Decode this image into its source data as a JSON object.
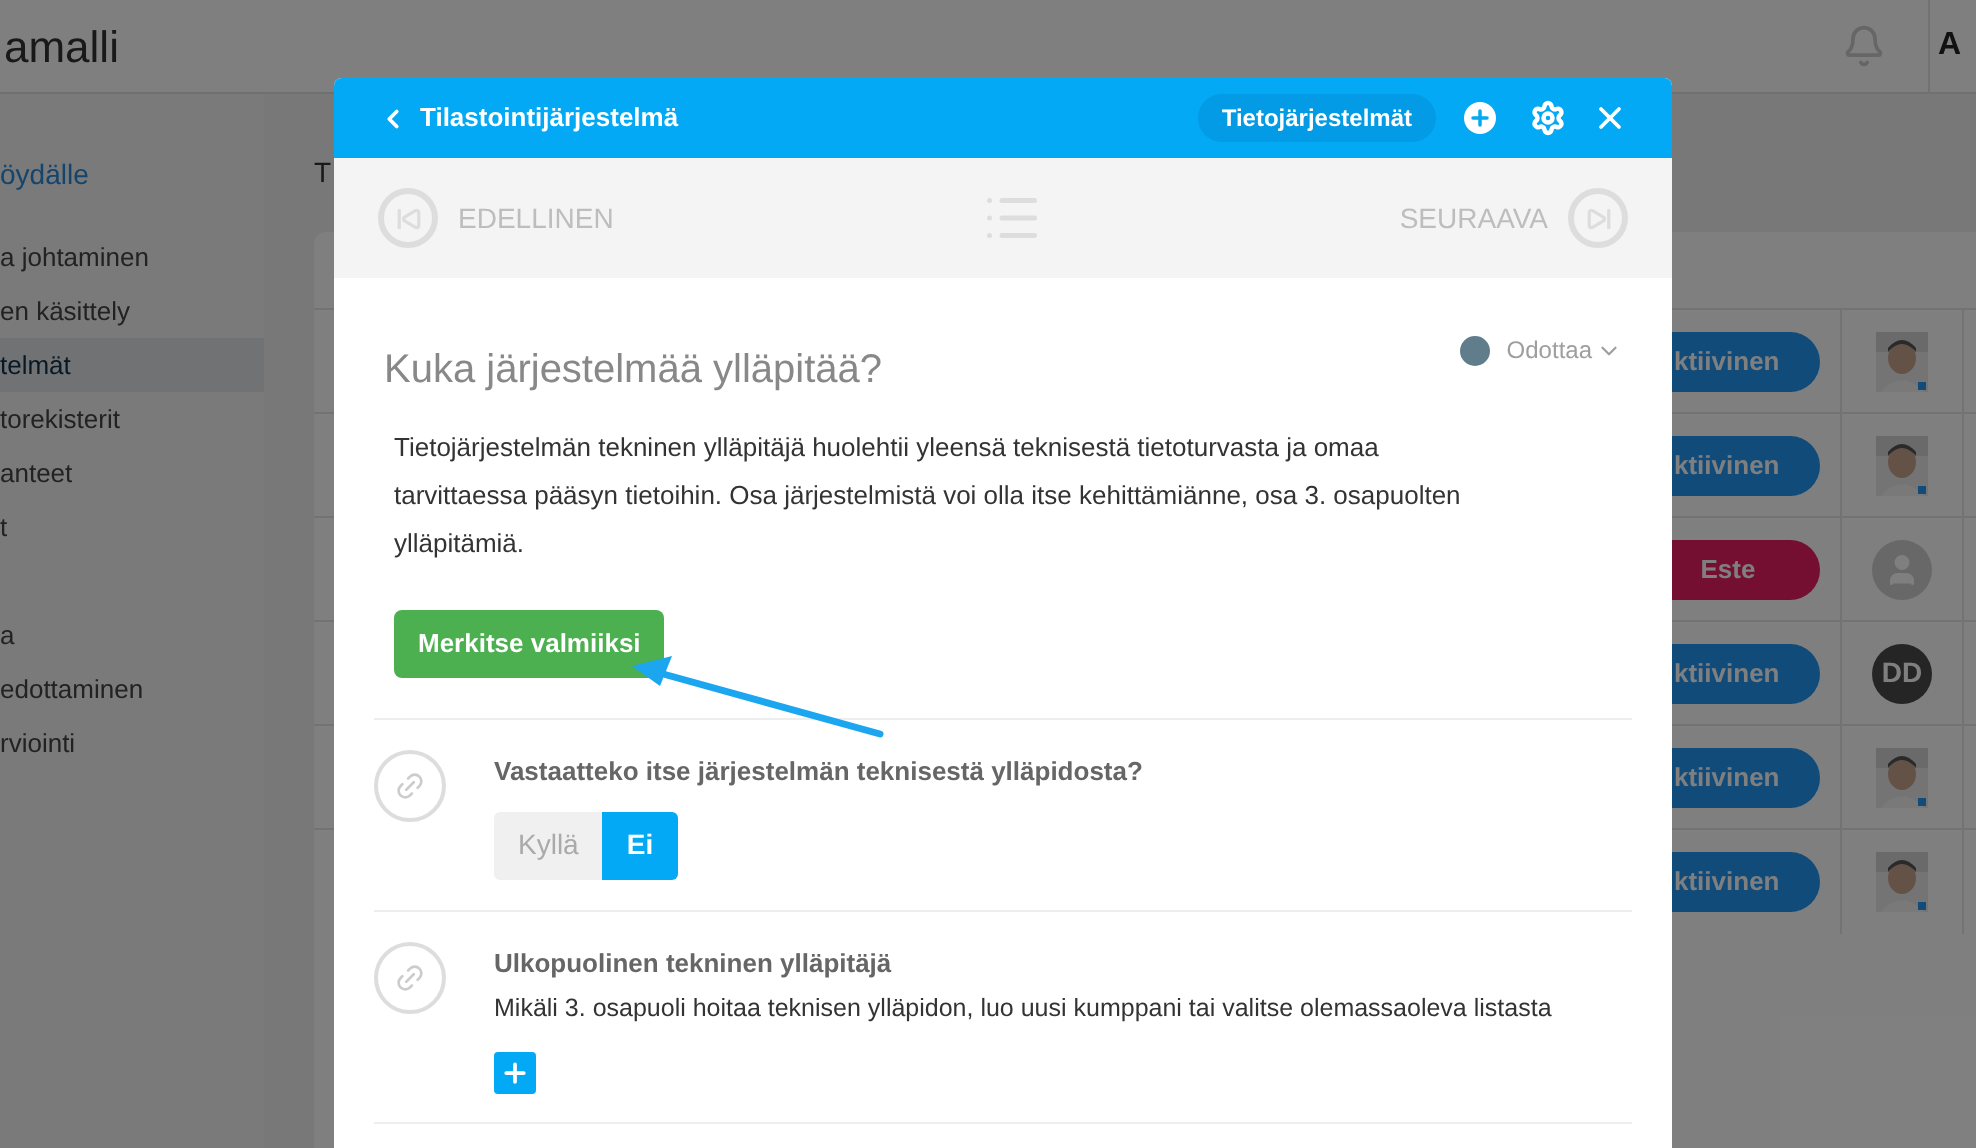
{
  "app": {
    "title": "amalli",
    "user_initial": "A"
  },
  "sidebar": {
    "items": [
      {
        "label": "öydälle",
        "kind": "back-link",
        "selected": false
      },
      {
        "label": "a johtaminen",
        "kind": "item",
        "selected": false
      },
      {
        "label": "en käsittely",
        "kind": "item",
        "selected": false
      },
      {
        "label": "telmät",
        "kind": "item",
        "selected": true
      },
      {
        "label": "torekisterit",
        "kind": "item",
        "selected": false
      },
      {
        "label": "anteet",
        "kind": "item",
        "selected": false
      },
      {
        "label": "t",
        "kind": "item",
        "selected": false
      },
      {
        "label": "a",
        "kind": "item",
        "selected": false
      },
      {
        "label": "edottaminen",
        "kind": "item",
        "selected": false
      },
      {
        "label": "rviointi",
        "kind": "item",
        "selected": false
      }
    ]
  },
  "main": {
    "heading": "T"
  },
  "table": {
    "rows": [
      {
        "status": "ktiivinen",
        "kind": "active"
      },
      {
        "status": "ktiivinen",
        "kind": "active"
      },
      {
        "status": "Este",
        "kind": "blocked",
        "avatar": {
          "kind": "placeholder"
        }
      },
      {
        "status": "ktiivinen",
        "kind": "active",
        "avatar": {
          "kind": "initials",
          "text": "DD"
        }
      },
      {
        "status": "ktiivinen",
        "kind": "active"
      },
      {
        "status": "ktiivinen",
        "kind": "active"
      }
    ]
  },
  "modal": {
    "title": "Tilastointijärjestelmä",
    "category": "Tietojärjestelmät",
    "nav": {
      "previous": "EDELLINEN",
      "next": "SEURAAVA"
    },
    "task": {
      "title": "Kuka järjestelmää ylläpitää?",
      "status": {
        "label": "Odottaa",
        "color": "#607d8b"
      },
      "description": "Tietojärjestelmän tekninen ylläpitäjä huolehtii yleensä teknisestä tietoturvasta ja omaa tarvittaessa pääsyn tietoihin. Osa järjestelmistä voi olla itse kehittämiänne, osa 3. osapuolten ylläpitämiä.",
      "button": "Merkitse valmiiksi"
    },
    "questions": [
      {
        "kind": "choice",
        "title": "Vastaatteko itse järjestelmän teknisestä ylläpidosta?",
        "options": [
          {
            "label": "Kyllä",
            "selected": false
          },
          {
            "label": "Ei",
            "selected": true
          }
        ]
      },
      {
        "kind": "add",
        "title": "Ulkopuolinen tekninen ylläpitäjä",
        "description": "Mikäli 3. osapuoli hoitaa teknisen ylläpidon, luo uusi kumppani tai valitse olemassaoleva listasta"
      }
    ]
  }
}
